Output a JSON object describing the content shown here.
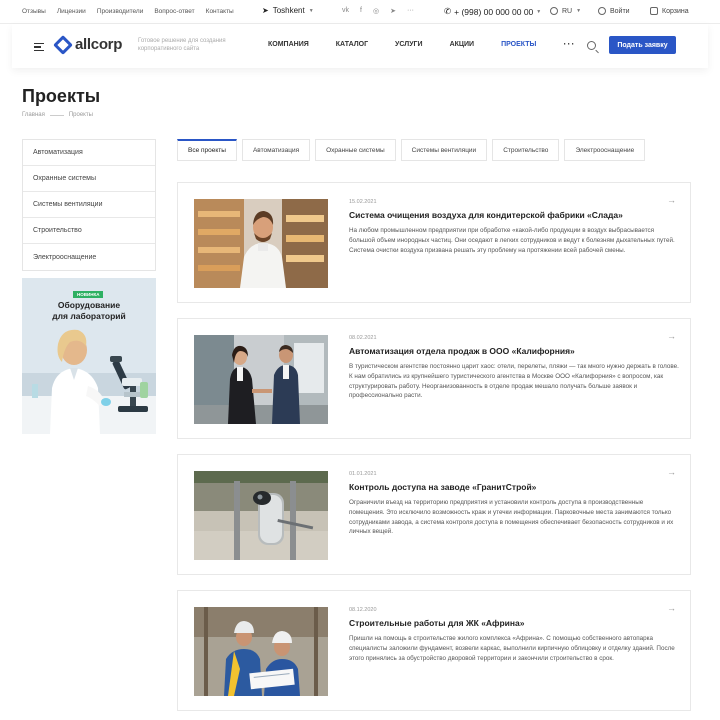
{
  "topbar": {
    "links": [
      "Отзывы",
      "Лицензии",
      "Производители",
      "Вопрос-ответ",
      "Контакты"
    ],
    "city": "Toshkent",
    "phone": "+ (998) 00 000 00 00",
    "lang": "RU",
    "login": "Войти",
    "cart": "Корзина"
  },
  "header": {
    "logo": "allcorp",
    "tagline": "Готовое решение для создания корпоративного сайта",
    "nav": [
      "Компания",
      "Каталог",
      "Услуги",
      "Акции",
      "Проекты"
    ],
    "nav_active": "Проекты",
    "more": "···",
    "cta": "Подать заявку",
    "accent": "#2a56c6"
  },
  "page": {
    "title": "Проекты",
    "breadcrumb": [
      "Главная",
      "Проекты"
    ]
  },
  "sidebar": {
    "items": [
      "Автоматизация",
      "Охранные системы",
      "Системы вентиляции",
      "Строительство",
      "Электрооснащение"
    ],
    "promo": {
      "badge": "НОВИНКА",
      "title_line1": "Оборудование",
      "title_line2": "для лабораторий"
    }
  },
  "filters": {
    "tabs": [
      "Все проекты",
      "Автоматизация",
      "Охранные системы",
      "Системы вентиляции",
      "Строительство",
      "Электрооснащение"
    ],
    "active": "Все проекты"
  },
  "projects": [
    {
      "date": "15.02.2021",
      "title": "Система очищения воздуха для кондитерской фабрики «Слада»",
      "text": "На любом промышленном предприятии при обработке «какой-либо продукции в воздух выбрасывается большой объем инородных частиц. Они оседают в легких сотрудников и ведут к болезням дыхательных путей. Система очистки воздуха призвана решать эту проблему на протяжении всей рабочей смены."
    },
    {
      "date": "08.02.2021",
      "title": "Автоматизация отдела продаж в ООО «Калифорния»",
      "text": "В туристическом агентстве постоянно царит хаос: отели, перелеты, пляжи — так много нужно держать в голове. К нам обратились из крупнейшего туристического агентства в Москве ООО «Калифорния» с вопросом, как структурировать работу. Неорганизованность в отделе продаж мешало получать больше заявок и профессионально расти."
    },
    {
      "date": "01.01.2021",
      "title": "Контроль доступа на заводе «ГранитСтрой»",
      "text": "Ограничили въезд на территорию предприятия и установили контроль доступа в производственные помещения. Это исключило возможность краж и утечки информации. Парковочные места занимаются только сотрудниками завода, а система контроля доступа в помещения обеспечивает безопасность сотрудников и их личных вещей."
    },
    {
      "date": "08.12.2020",
      "title": "Строительные работы для ЖК «Африна»",
      "text": "Пришли на помощь в строительстве жилого комплекса «Африна». С помощью собственного автопарка специалисты заложили фундамент, возвели каркас, выполнили кирпичную облицовку и отделку зданий. После этого принялись за обустройство дворовой территории и закончили строительство в срок."
    }
  ]
}
